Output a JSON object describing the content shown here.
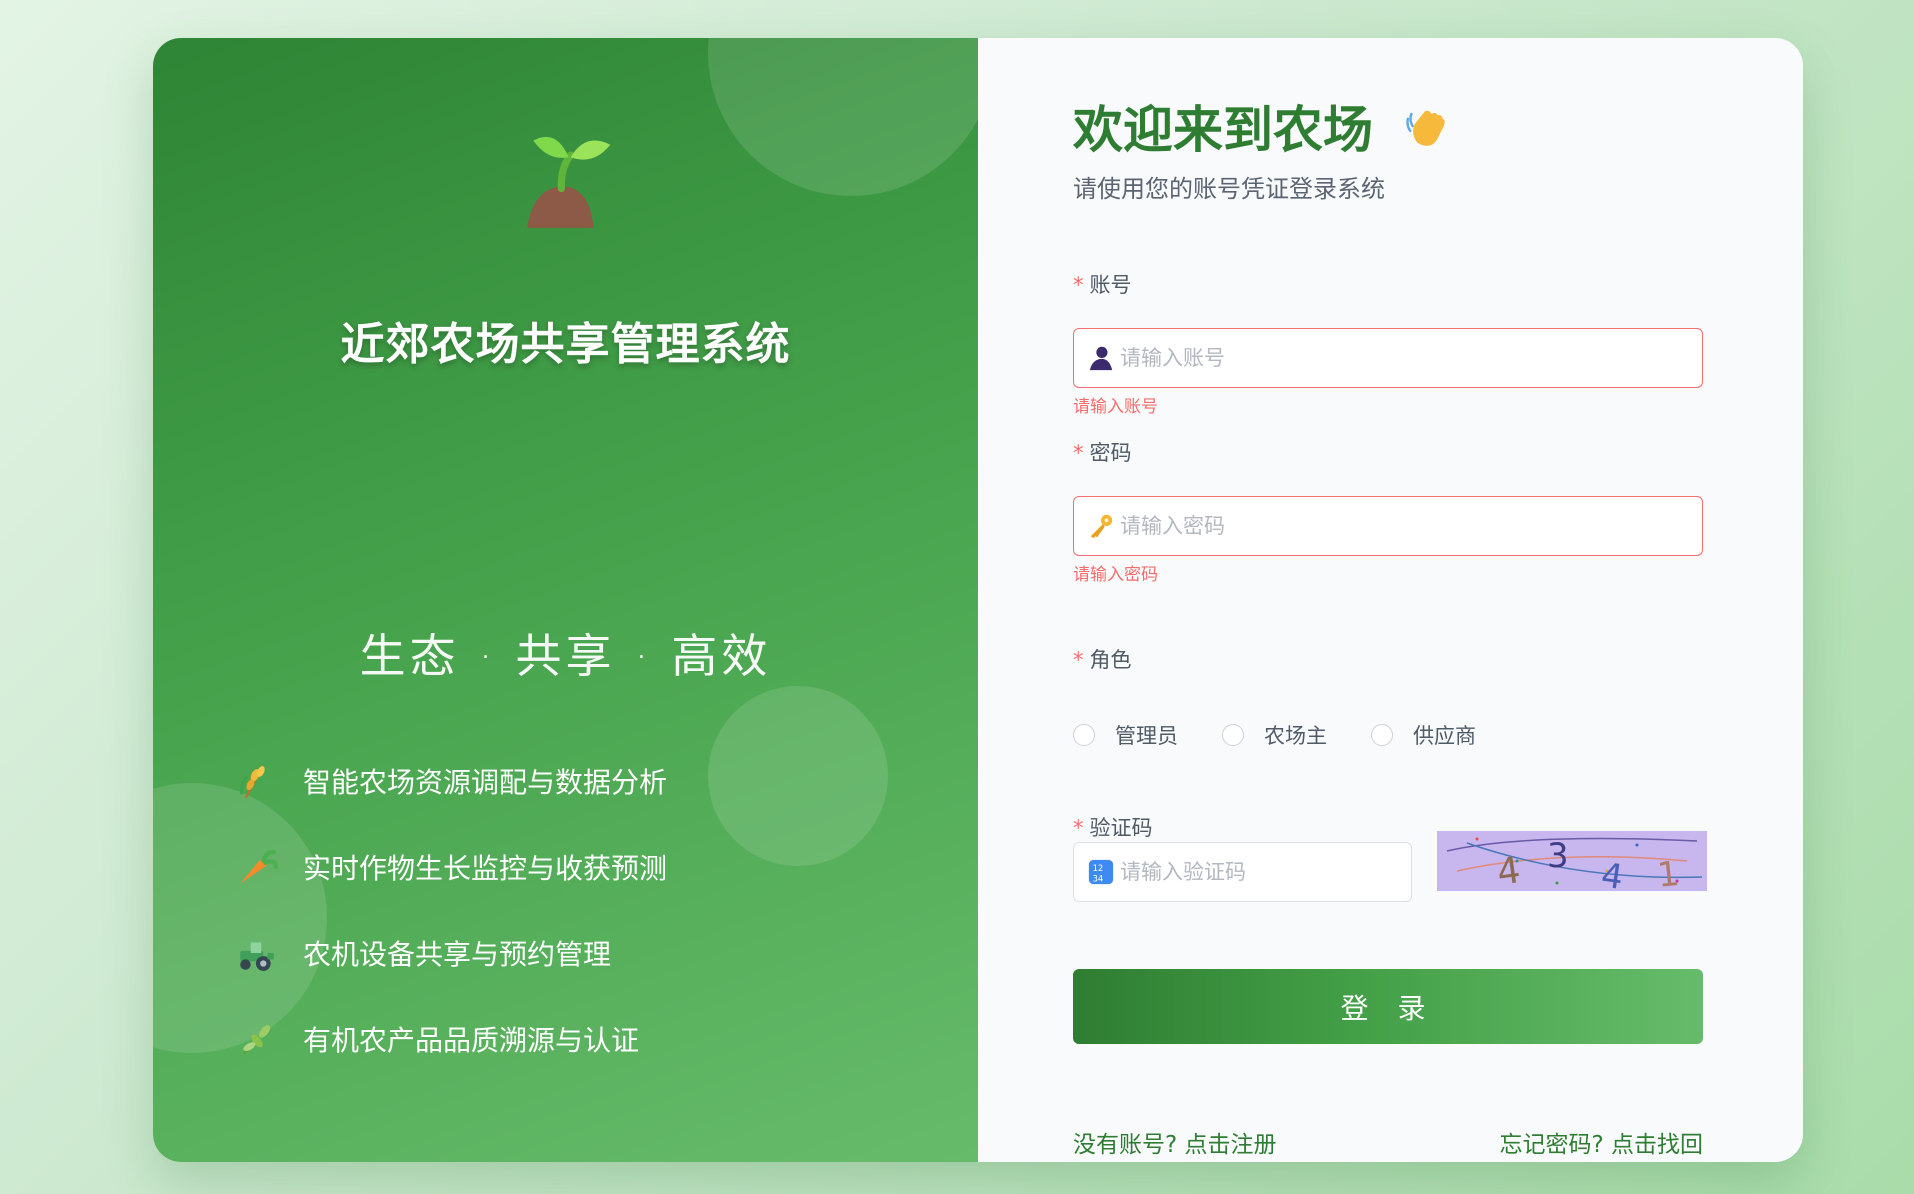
{
  "brand": {
    "system_title": "近郊农场共享管理系统",
    "tagline": "生态 · 共享 · 高效",
    "features": [
      {
        "icon": "wheat-icon",
        "text": "智能农场资源调配与数据分析"
      },
      {
        "icon": "carrot-icon",
        "text": "实时作物生长监控与收获预测"
      },
      {
        "icon": "tractor-icon",
        "text": "农机设备共享与预约管理"
      },
      {
        "icon": "herb-icon",
        "text": "有机农产品品质溯源与认证"
      }
    ]
  },
  "login": {
    "welcome": "欢迎来到农场",
    "subtitle": "请使用您的账号凭证登录系统",
    "required_mark": "*",
    "account": {
      "label": "账号",
      "placeholder": "请输入账号",
      "value": "",
      "error": "请输入账号",
      "icon": "user-icon"
    },
    "password": {
      "label": "密码",
      "placeholder": "请输入密码",
      "value": "",
      "error": "请输入密码",
      "icon": "key-icon"
    },
    "role": {
      "label": "角色",
      "options": [
        "管理员",
        "农场主",
        "供应商"
      ],
      "selected": null
    },
    "captcha": {
      "label": "验证码",
      "placeholder": "请输入验证码",
      "value": "",
      "icon": "numbers-icon",
      "image_text": "4341"
    },
    "submit_label": "登 录",
    "register_link": "没有账号? 点击注册",
    "forgot_link": "忘记密码? 点击找回"
  },
  "colors": {
    "primary": "#2e7d32",
    "error": "#f56c6c",
    "accent_light": "#66bb6a"
  }
}
